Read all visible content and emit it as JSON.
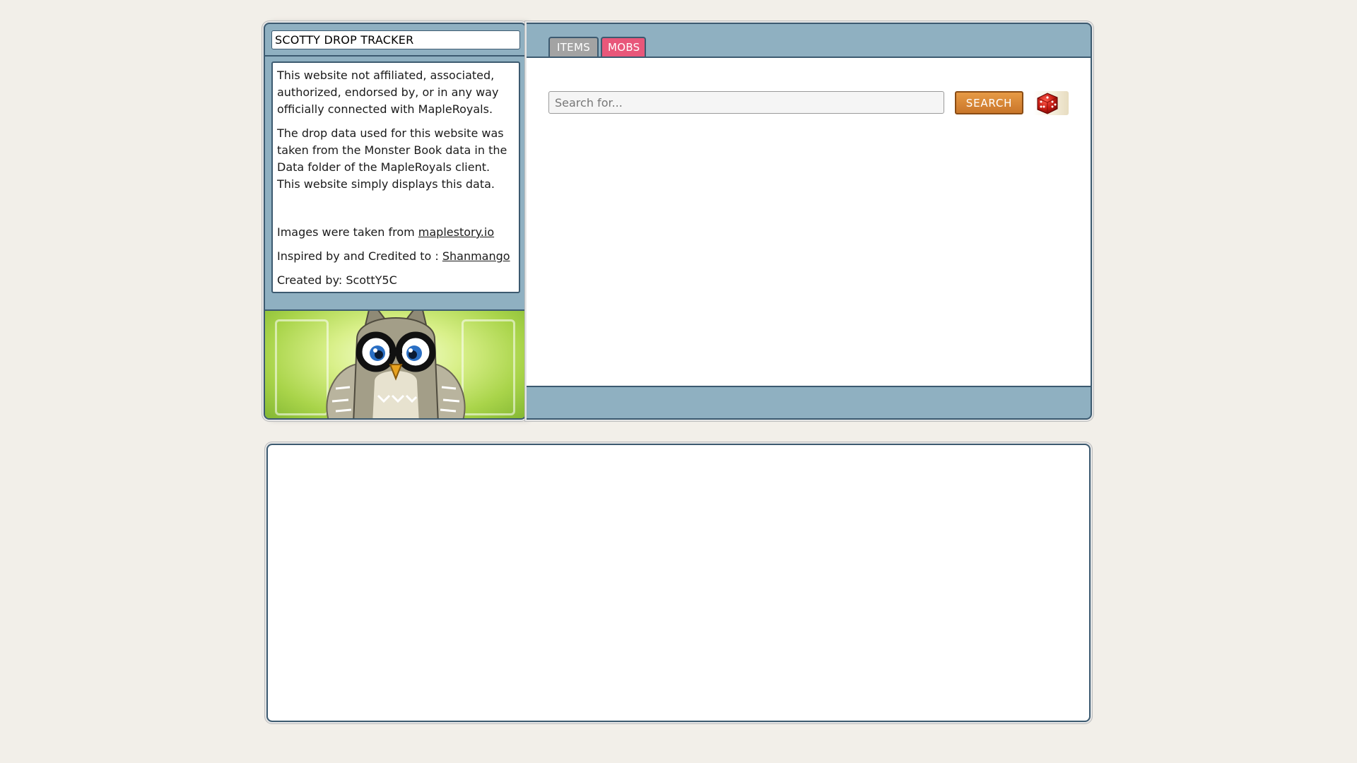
{
  "app": {
    "title": "SCOTTY DROP TRACKER"
  },
  "info": {
    "disclaimer": "This website not affiliated, associated, authorized, endorsed by, or in any way officially connected with MapleRoyals.",
    "data_source": "The drop data used for this website was taken from the Monster Book data in the Data folder of the MapleRoyals client. This website simply displays this data.",
    "images_prefix": "Images were taken from ",
    "images_link": "maplestory.io",
    "credit_prefix": "Inspired by and Credited to : ",
    "credit_link": "Shanmango",
    "created_by": "Created by: ScottY5C"
  },
  "tabs": [
    {
      "label": "ITEMS",
      "active": false,
      "color": "#a3a3a3"
    },
    {
      "label": "MOBS",
      "active": true,
      "color": "#e8577a"
    }
  ],
  "search": {
    "placeholder": "Search for...",
    "value": "",
    "button_label": "SEARCH"
  },
  "icons": {
    "random": "dice-icon",
    "banner": "owl-illustration"
  },
  "colors": {
    "panel": "#8fb0c1",
    "border": "#3c5a70",
    "search_button": "#d4843a",
    "mobs_tab": "#e8577a",
    "items_tab": "#a3a3a3",
    "background": "#f2efe9"
  }
}
